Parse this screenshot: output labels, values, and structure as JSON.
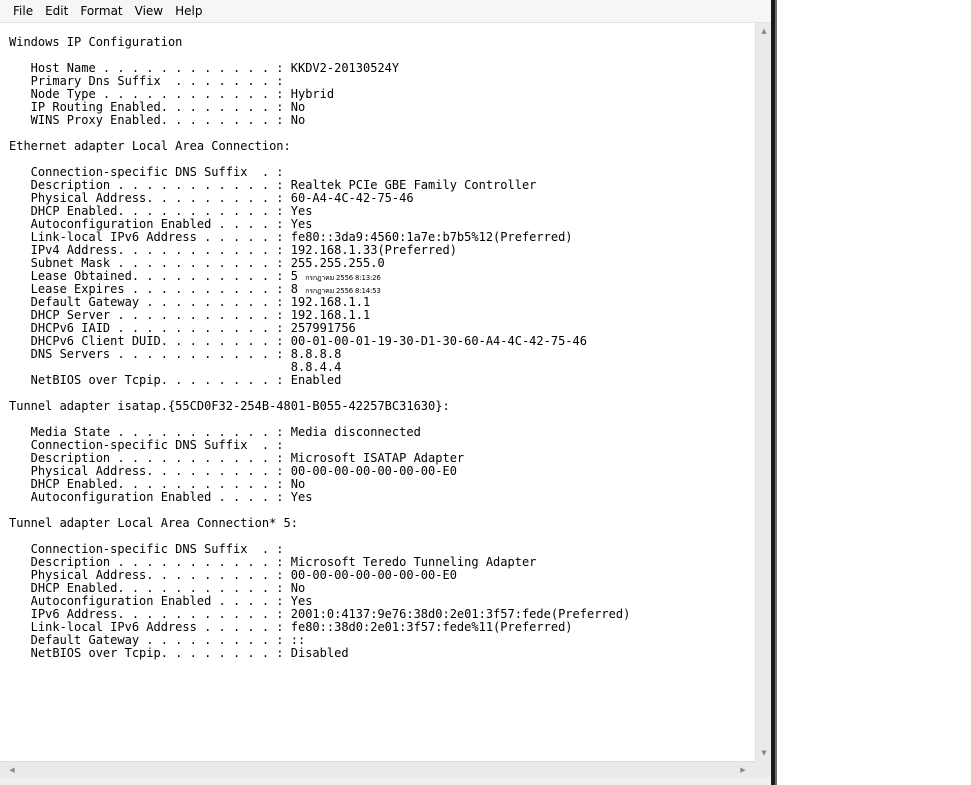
{
  "menubar": {
    "items": [
      "File",
      "Edit",
      "Format",
      "View",
      "Help"
    ]
  },
  "document": {
    "lines": [
      {
        "text": "Windows IP Configuration"
      },
      {
        "text": ""
      },
      {
        "text": "   Host Name . . . . . . . . . . . . : KKDV2-20130524Y"
      },
      {
        "text": "   Primary Dns Suffix  . . . . . . . : "
      },
      {
        "text": "   Node Type . . . . . . . . . . . . : Hybrid"
      },
      {
        "text": "   IP Routing Enabled. . . . . . . . : No"
      },
      {
        "text": "   WINS Proxy Enabled. . . . . . . . : No"
      },
      {
        "text": ""
      },
      {
        "text": "Ethernet adapter Local Area Connection:"
      },
      {
        "text": ""
      },
      {
        "text": "   Connection-specific DNS Suffix  . : "
      },
      {
        "text": "   Description . . . . . . . . . . . : Realtek PCIe GBE Family Controller"
      },
      {
        "text": "   Physical Address. . . . . . . . . : 60-A4-4C-42-75-46"
      },
      {
        "text": "   DHCP Enabled. . . . . . . . . . . : Yes"
      },
      {
        "text": "   Autoconfiguration Enabled . . . . : Yes"
      },
      {
        "text": "   Link-local IPv6 Address . . . . . : fe80::3da9:4560:1a7e:b7b5%12(Preferred)"
      },
      {
        "text": "   IPv4 Address. . . . . . . . . . . : 192.168.1.33(Preferred)"
      },
      {
        "text": "   Subnet Mask . . . . . . . . . . . : 255.255.255.0"
      },
      {
        "text": "   Lease Obtained. . . . . . . . . . : 5 ",
        "small": "กรกฎาคม 2556 8:13:26"
      },
      {
        "text": "   Lease Expires . . . . . . . . . . : 8 ",
        "small": "กรกฎาคม 2556 8:14:53"
      },
      {
        "text": "   Default Gateway . . . . . . . . . : 192.168.1.1"
      },
      {
        "text": "   DHCP Server . . . . . . . . . . . : 192.168.1.1"
      },
      {
        "text": "   DHCPv6 IAID . . . . . . . . . . . : 257991756"
      },
      {
        "text": "   DHCPv6 Client DUID. . . . . . . . : 00-01-00-01-19-30-D1-30-60-A4-4C-42-75-46"
      },
      {
        "text": "   DNS Servers . . . . . . . . . . . : 8.8.8.8"
      },
      {
        "text": "                                       8.8.4.4"
      },
      {
        "text": "   NetBIOS over Tcpip. . . . . . . . : Enabled"
      },
      {
        "text": ""
      },
      {
        "text": "Tunnel adapter isatap.{55CD0F32-254B-4801-B055-42257BC31630}:"
      },
      {
        "text": ""
      },
      {
        "text": "   Media State . . . . . . . . . . . : Media disconnected"
      },
      {
        "text": "   Connection-specific DNS Suffix  . : "
      },
      {
        "text": "   Description . . . . . . . . . . . : Microsoft ISATAP Adapter"
      },
      {
        "text": "   Physical Address. . . . . . . . . : 00-00-00-00-00-00-00-E0"
      },
      {
        "text": "   DHCP Enabled. . . . . . . . . . . : No"
      },
      {
        "text": "   Autoconfiguration Enabled . . . . : Yes"
      },
      {
        "text": ""
      },
      {
        "text": "Tunnel adapter Local Area Connection* 5:"
      },
      {
        "text": ""
      },
      {
        "text": "   Connection-specific DNS Suffix  . : "
      },
      {
        "text": "   Description . . . . . . . . . . . : Microsoft Teredo Tunneling Adapter"
      },
      {
        "text": "   Physical Address. . . . . . . . . : 00-00-00-00-00-00-00-E0"
      },
      {
        "text": "   DHCP Enabled. . . . . . . . . . . : No"
      },
      {
        "text": "   Autoconfiguration Enabled . . . . : Yes"
      },
      {
        "text": "   IPv6 Address. . . . . . . . . . . : 2001:0:4137:9e76:38d0:2e01:3f57:fede(Preferred)"
      },
      {
        "text": "   Link-local IPv6 Address . . . . . : fe80::38d0:2e01:3f57:fede%11(Preferred)"
      },
      {
        "text": "   Default Gateway . . . . . . . . . : ::"
      },
      {
        "text": "   NetBIOS over Tcpip. . . . . . . . : Disabled"
      }
    ]
  },
  "scrollbar": {
    "up_arrow_icon": "triangle-up",
    "down_arrow_icon": "triangle-down",
    "left_arrow_icon": "triangle-left",
    "right_arrow_icon": "triangle-right",
    "up_glyph": "▲",
    "down_glyph": "▼",
    "left_glyph": "◀",
    "right_glyph": "▶"
  }
}
